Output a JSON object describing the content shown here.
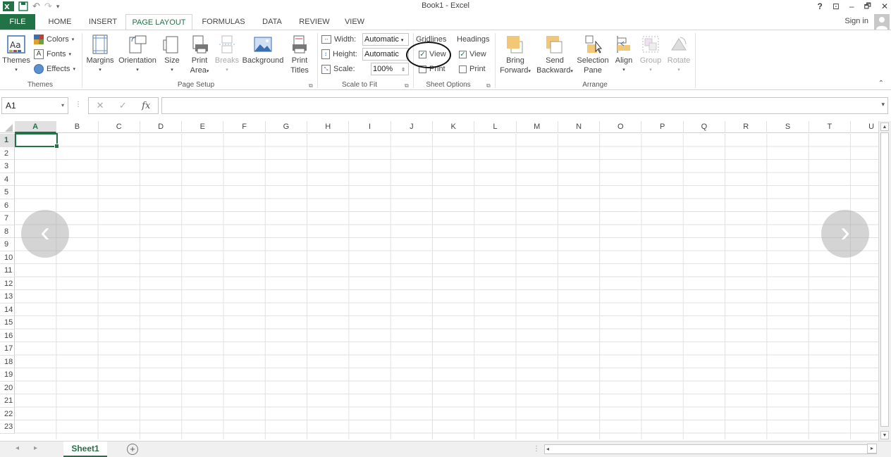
{
  "titlebar": {
    "title": "Book1 - Excel",
    "help": "?",
    "restore_ribbon": "⊡",
    "minimize": "–",
    "restore": "🗗",
    "close": "✕"
  },
  "tabs": [
    "FILE",
    "HOME",
    "INSERT",
    "PAGE LAYOUT",
    "FORMULAS",
    "DATA",
    "REVIEW",
    "VIEW"
  ],
  "active_tab": "PAGE LAYOUT",
  "signin": "Sign in",
  "ribbon": {
    "themes": {
      "themes_label": "Themes",
      "colors_label": "Colors",
      "fonts_label": "Fonts",
      "effects_label": "Effects",
      "group_label": "Themes"
    },
    "page_setup": {
      "margins": "Margins",
      "orientation": "Orientation",
      "size": "Size",
      "print_area_1": "Print",
      "print_area_2": "Area",
      "breaks": "Breaks",
      "background": "Background",
      "print_titles_1": "Print",
      "print_titles_2": "Titles",
      "group_label": "Page Setup"
    },
    "scale_to_fit": {
      "width_label": "Width:",
      "width_value": "Automatic",
      "height_label": "Height:",
      "height_value": "Automatic",
      "scale_label": "Scale:",
      "scale_value": "100%",
      "group_label": "Scale to Fit"
    },
    "sheet_options": {
      "gridlines_label": "Gridlines",
      "headings_label": "Headings",
      "view_label": "View",
      "print_label": "Print",
      "gridlines_view": true,
      "gridlines_print": false,
      "headings_view": true,
      "headings_print": false,
      "group_label": "Sheet Options"
    },
    "arrange": {
      "bring_forward_1": "Bring",
      "bring_forward_2": "Forward",
      "send_backward_1": "Send",
      "send_backward_2": "Backward",
      "selection_pane_1": "Selection",
      "selection_pane_2": "Pane",
      "align": "Align",
      "group": "Group",
      "rotate": "Rotate",
      "group_label": "Arrange"
    }
  },
  "formula_bar": {
    "name_box": "A1",
    "fx": "fx",
    "cancel": "✕",
    "enter": "✓",
    "value": ""
  },
  "columns": [
    "A",
    "B",
    "C",
    "D",
    "E",
    "F",
    "G",
    "H",
    "I",
    "J",
    "K",
    "L",
    "M",
    "N",
    "O",
    "P",
    "Q",
    "R",
    "S",
    "T",
    "U"
  ],
  "rows": [
    "1",
    "2",
    "3",
    "4",
    "5",
    "6",
    "7",
    "8",
    "9",
    "10",
    "11",
    "12",
    "13",
    "14",
    "15",
    "16",
    "17",
    "18",
    "19",
    "20",
    "21",
    "22",
    "23"
  ],
  "selected_cell": "A1",
  "sheet_tab": "Sheet1",
  "colors": {
    "accent": "#217346",
    "gridline": "#e2e2e2"
  }
}
